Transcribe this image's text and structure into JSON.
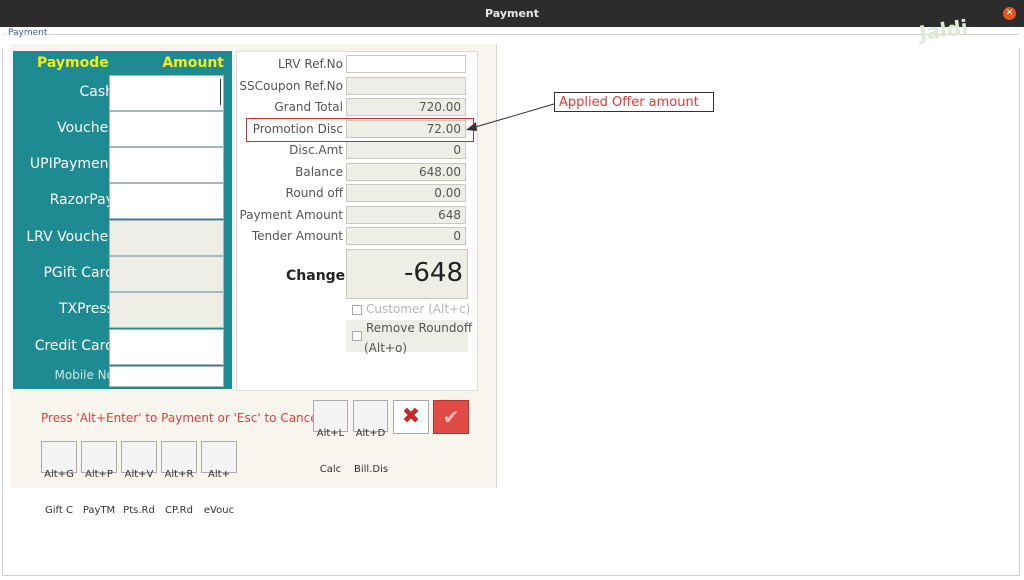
{
  "window": {
    "title": "Payment",
    "close_icon": "close-icon",
    "watermark": "Jaldi"
  },
  "group_label": "Payment",
  "paymodes": {
    "header_mode": "Paymode",
    "header_amount": "Amount",
    "items": [
      {
        "label": "Cash",
        "value": "",
        "enabled": true
      },
      {
        "label": "Voucher",
        "value": "",
        "enabled": true
      },
      {
        "label": "UPIPayment",
        "value": "",
        "enabled": true
      },
      {
        "label": "RazorPay",
        "value": "",
        "enabled": true
      },
      {
        "label": "LRV Voucher",
        "value": "",
        "enabled": false
      },
      {
        "label": "PGift Card",
        "value": "",
        "enabled": false
      },
      {
        "label": "TXPress",
        "value": "",
        "enabled": false
      },
      {
        "label": "Credit Card",
        "value": "",
        "enabled": true
      }
    ],
    "mobile_label": "Mobile No",
    "mobile_value": ""
  },
  "fields": {
    "lrv_ref": {
      "label": "LRV Ref.No",
      "value": ""
    },
    "sscoupon_ref": {
      "label": "SSCoupon Ref.No",
      "value": ""
    },
    "grand_total": {
      "label": "Grand Total",
      "value": "720.00"
    },
    "promotion_disc": {
      "label": "Promotion Disc",
      "value": "72.00"
    },
    "disc_amt": {
      "label": "Disc.Amt",
      "value": "0"
    },
    "balance": {
      "label": "Balance",
      "value": "648.00"
    },
    "round_off": {
      "label": "Round off",
      "value": "0.00"
    },
    "payment_amount": {
      "label": "Payment Amount",
      "value": "648"
    },
    "tender_amount": {
      "label": "Tender Amount",
      "value": "0"
    }
  },
  "change": {
    "label": "Change",
    "value": "-648"
  },
  "checkboxes": {
    "customer": "Customer (Alt+c)",
    "remove_roundoff_1": "Remove Roundoff",
    "remove_roundoff_2": "(Alt+o)"
  },
  "press_hint": "Press 'Alt+Enter' to Payment or 'Esc' to Cancel",
  "shortcuts": {
    "calc": {
      "key": "Alt+L",
      "label": "Calc"
    },
    "billdis": {
      "key": "Alt+D",
      "label": "Bill.Dis"
    },
    "giftc": {
      "key": "Alt+G",
      "label": "Gift C"
    },
    "paytm": {
      "key": "Alt+P",
      "label": "PayTM"
    },
    "ptsrd": {
      "key": "Alt+V",
      "label": "Pts.Rd"
    },
    "cprd": {
      "key": "Alt+R",
      "label": "CP.Rd"
    },
    "evouc": {
      "key": "Alt+",
      "label": "eVouc"
    }
  },
  "annotation": "Applied Offer amount",
  "colors": {
    "paylist_bg": "#1e8a92",
    "header_yellow": "#f2ee1a",
    "accent_red": "#e04b45"
  }
}
